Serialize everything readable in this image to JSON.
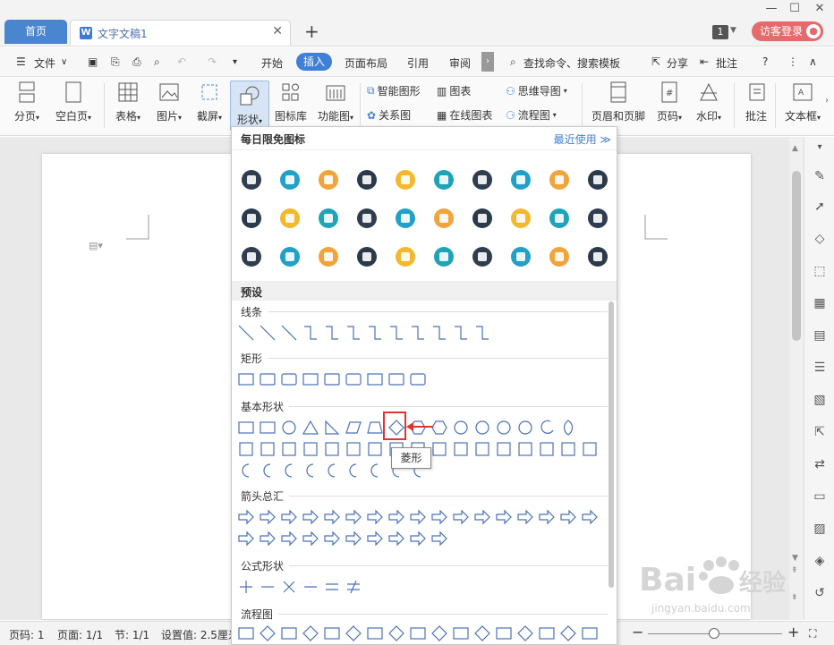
{
  "tabs": {
    "home": "首页",
    "doc": "文字文稿1",
    "new_tab": "+"
  },
  "titlebar": {
    "badge": "1",
    "login": "访客登录"
  },
  "menu": {
    "file": "文件",
    "items": [
      "开始",
      "插入",
      "页面布局",
      "引用",
      "审阅"
    ],
    "search": "查找命令、搜索模板",
    "share": "分享",
    "comment": "批注",
    "help": "?"
  },
  "ribbon": {
    "page_break": "分页",
    "blank_page": "空白页",
    "table": "表格",
    "picture": "图片",
    "screenshot": "截屏",
    "shape": "形状",
    "icon_lib": "图标库",
    "func_chart": "功能图",
    "smart_shape": "智能图形",
    "chart": "图表",
    "mind_map": "思维导图",
    "relation": "关系图",
    "online_chart": "在线图表",
    "flowchart": "流程图",
    "header_footer": "页眉和页脚",
    "page_num": "页码",
    "watermark": "水印",
    "comment": "批注",
    "textbox": "文本框"
  },
  "dropdown": {
    "daily_icons": "每日限免图标",
    "recent": "最近使用",
    "preset": "预设",
    "lines": "线条",
    "rect": "矩形",
    "basic": "基本形状",
    "arrows": "箭头总汇",
    "formula": "公式形状",
    "flow": "流程图",
    "tooltip": "菱形"
  },
  "status": {
    "page": "页码: 1",
    "pages": "页面: 1/1",
    "section": "节: 1/1",
    "settings": "设置值: 2.5厘米"
  },
  "watermark": {
    "text": "Baidu经验",
    "url": "jingyan.baidu.com"
  },
  "colors": {
    "accent": "#3f7fd6",
    "highlight": "#e03333"
  }
}
